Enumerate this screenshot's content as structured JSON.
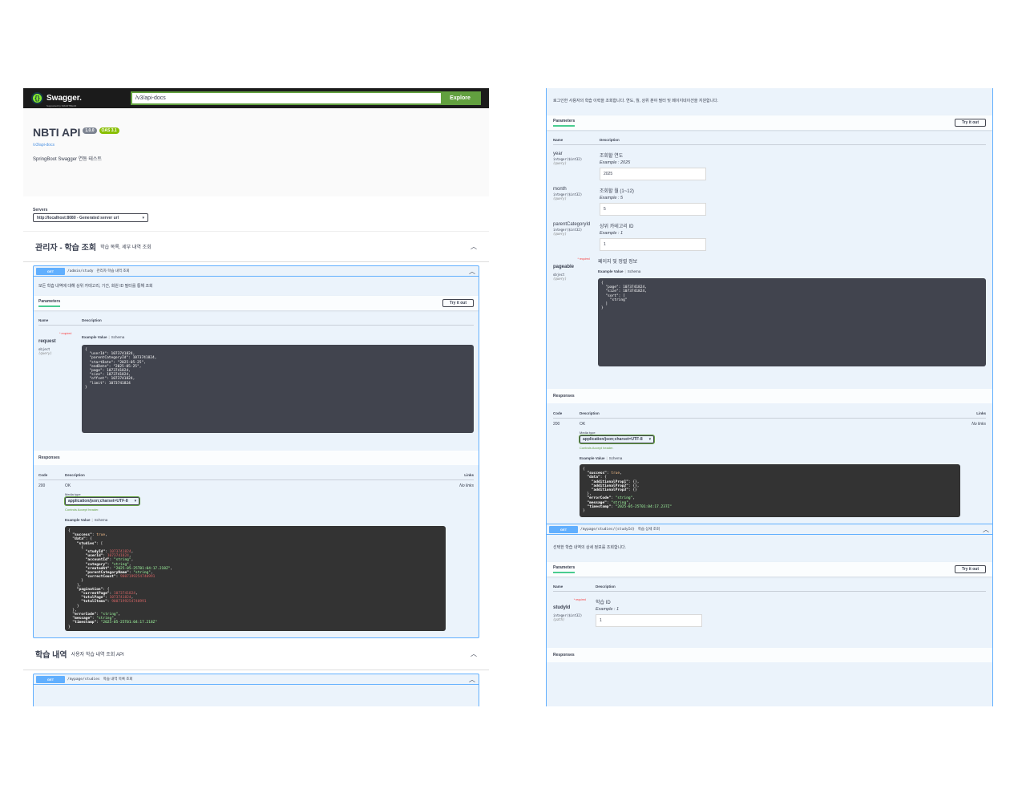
{
  "topbar": {
    "logo_text": "Swagger.",
    "logo_sub": "Supported by SMARTBEAR",
    "url_value": "/v3/api-docs",
    "explore_label": "Explore"
  },
  "info": {
    "title": "NBTI API",
    "version": "1.0.0",
    "oas": "OAS 3.1",
    "link": "/v3/api-docs",
    "description": "SpringBoot Swagger 연동 테스트"
  },
  "servers": {
    "label": "Servers",
    "selected": "http://localhost:8080 - Generated server url"
  },
  "admin_tag": {
    "name": "관리자 - 학습 조회",
    "description": "학습 목록, 세부 내역 조회"
  },
  "admin_op": {
    "method": "GET",
    "path": "/admin/study",
    "summary": "관리자 학습 내역 조회",
    "description": "모든 학습 내역에 대해 상위 카테고리, 기간, 회원 ID 필터를 통해 조회",
    "parameters_label": "Parameters",
    "try_label": "Try it out",
    "col_name": "Name",
    "col_desc": "Description",
    "param": {
      "name": "request",
      "required": "* required",
      "type": "object",
      "in": "(query)",
      "example_value_tab": "Example Value",
      "schema_tab": "Schema",
      "example_json": "{\n  \"userId\": 1073741824,\n  \"parentCategoryId\": 1073741824,\n  \"startDate\": \"2025-05-25\",\n  \"endDate\": \"2025-05-25\",\n  \"page\": 1073741824,\n  \"size\": 1073741824,\n  \"offset\": 1073741824,\n  \"limit\": 1073741824\n}"
    },
    "responses_label": "Responses",
    "resp_col_code": "Code",
    "resp_col_desc": "Description",
    "resp_col_links": "Links",
    "resp_code": "200",
    "resp_desc": "OK",
    "resp_links": "No links",
    "media_type_label": "Media type",
    "media_type": "application/json;charset=UTF-8",
    "controls": "Controls Accept header.",
    "resp_example_tab": "Example Value",
    "resp_schema_tab": "Schema"
  },
  "study_tag": {
    "name": "학습 내역",
    "description": "사용자 학습 내역 조회 API"
  },
  "study_list_op": {
    "method": "GET",
    "path": "/mypage/studies",
    "summary": "학습 내역 목록 조회"
  },
  "right": {
    "description": "로그인한 사용자의 학습 이력을 조회합니다. 연도, 월, 상위 분야 필터 및 페이지네이션을 지원합니다.",
    "parameters_label": "Parameters",
    "try_label": "Try it out",
    "col_name": "Name",
    "col_desc": "Description",
    "params": [
      {
        "name": "year",
        "type": "integer($int32)",
        "in": "(query)",
        "desc": "조회할 연도",
        "example": "Example : 2025",
        "value": "2025"
      },
      {
        "name": "month",
        "type": "integer($int32)",
        "in": "(query)",
        "desc": "조회할 월 (1~12)",
        "example": "Example : 5",
        "value": "5"
      },
      {
        "name": "parentCategoryId",
        "type": "integer($int32)",
        "in": "(query)",
        "desc": "상위 카테고리 ID",
        "example": "Example : 1",
        "value": "1"
      }
    ],
    "pageable": {
      "name": "pageable",
      "required": "* required",
      "type": "object",
      "in": "(query)",
      "desc": "페이지 및 정렬 정보",
      "example_value_tab": "Example Value",
      "schema_tab": "Schema"
    },
    "responses_label": "Responses",
    "resp_col_code": "Code",
    "resp_col_desc": "Description",
    "resp_col_links": "Links",
    "resp_code": "200",
    "resp_desc": "OK",
    "resp_links": "No links",
    "media_type_label": "Media type",
    "media_type": "application/json;charset=UTF-8",
    "controls": "Controls Accept header.",
    "resp_example_tab": "Example Value",
    "resp_schema_tab": "Schema"
  },
  "detail_op": {
    "method": "GET",
    "path": "/mypage/studies/{studyId}",
    "summary": "학습 상세 조회",
    "description": "선택한 학습 내역의 상세 정보를 조회합니다.",
    "parameters_label": "Parameters",
    "try_label": "Try it out",
    "col_name": "Name",
    "col_desc": "Description",
    "param": {
      "name": "studyId",
      "required": "* required",
      "type": "integer($int32)",
      "in": "(path)",
      "desc": "학습 ID",
      "example": "Example : 1",
      "value": "1"
    },
    "responses_label": "Responses"
  },
  "colors": {
    "get": "#61affe",
    "accent_green": "#62a03f",
    "code_bg": "#41444e",
    "code_bg_dark": "#333333"
  }
}
